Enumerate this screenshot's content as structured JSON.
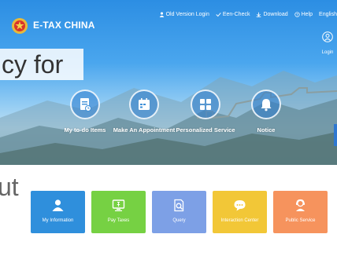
{
  "header": {
    "brand": "E-TAX CHINA",
    "links": [
      {
        "label": "Old Version Login",
        "icon": "user-icon"
      },
      {
        "label": "Een-Check",
        "icon": "check-icon"
      },
      {
        "label": "Download",
        "icon": "download-icon"
      },
      {
        "label": "Help",
        "icon": "help-icon"
      },
      {
        "label": "English"
      }
    ],
    "login": "Login"
  },
  "hero": {
    "headline": "cy for",
    "items": [
      {
        "label": "My to-do Items",
        "icon": "todo-document-icon"
      },
      {
        "label": "Make An Appointment",
        "icon": "calendar-icon"
      },
      {
        "label": "Personalized Service",
        "icon": "grid-icon"
      },
      {
        "label": "Notice",
        "icon": "bell-icon"
      }
    ]
  },
  "bottom_text": "ut",
  "tiles": [
    {
      "label": "My Information",
      "color": "#2f8fdc",
      "icon": "person-icon"
    },
    {
      "label": "Pay Taxes",
      "color": "#76d143",
      "icon": "monitor-icon"
    },
    {
      "label": "Query",
      "color": "#7da0e6",
      "icon": "search-document-icon"
    },
    {
      "label": "Interaction Center",
      "color": "#f2c737",
      "icon": "chat-bubble-icon"
    },
    {
      "label": "Public Service",
      "color": "#f6935d",
      "icon": "service-person-icon"
    }
  ]
}
